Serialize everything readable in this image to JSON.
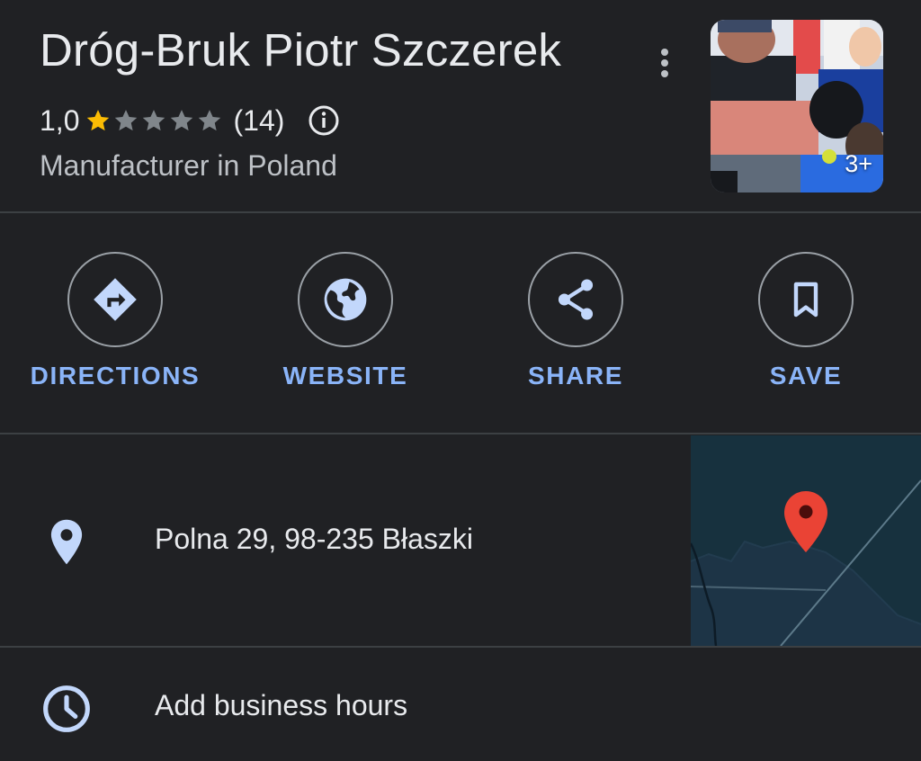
{
  "place": {
    "name": "Dróg-Bruk Piotr Szczerek",
    "rating": "1,0",
    "stars_filled": 1,
    "stars_total": 5,
    "review_count": "(14)",
    "category": "Manufacturer in Poland",
    "photo_count": "3+"
  },
  "actions": [
    {
      "label": "DIRECTIONS",
      "icon": "directions-icon"
    },
    {
      "label": "WEBSITE",
      "icon": "globe-icon"
    },
    {
      "label": "SHARE",
      "icon": "share-icon"
    },
    {
      "label": "SAVE",
      "icon": "bookmark-icon"
    }
  ],
  "address": {
    "text": "Polna 29, 98-235 Błaszki",
    "icon": "location-pin-icon"
  },
  "hours": {
    "text": "Add business hours",
    "icon": "clock-icon"
  },
  "colors": {
    "background": "#202124",
    "accent": "#8ab4f8",
    "star": "#fbbc04",
    "star_empty": "#80868b",
    "map_pin": "#ea4335"
  }
}
